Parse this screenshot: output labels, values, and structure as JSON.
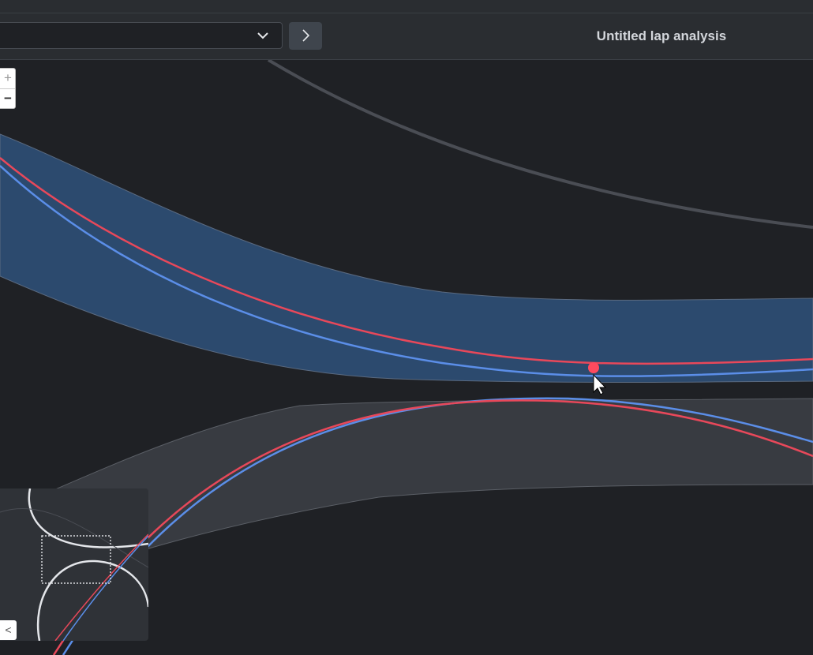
{
  "header": {
    "title": "Untitled lap analysis",
    "lap_select_value": ""
  },
  "zoom": {
    "in_label": "+",
    "out_label": "−"
  },
  "minimap": {
    "collapse_label": "<"
  },
  "colors": {
    "lap_a": "#e8485a",
    "lap_b": "#5b8ee8",
    "track_active": "#2c4a6e",
    "track_inactive": "#383b41",
    "background": "#1f2125"
  }
}
